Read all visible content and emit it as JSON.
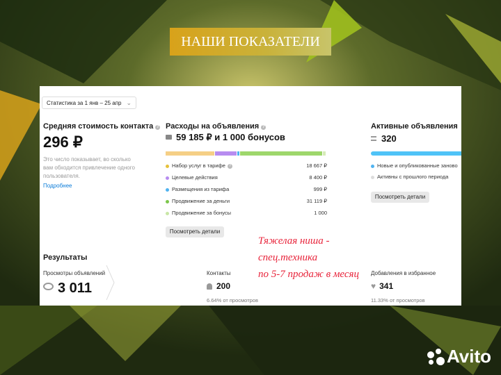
{
  "banner_title": "НАШИ ПОКАЗАТЕЛИ",
  "period_select": "Статистика за 1 янв – 25 апр",
  "contact_cost": {
    "title": "Средняя стоимость контакта",
    "value": "296 ₽",
    "hint": [
      "Это число показывает, во сколько",
      "вам обходится привлечение одного",
      "пользователя."
    ],
    "link": "Подробнее"
  },
  "expenses": {
    "title": "Расходы на объявления",
    "total_rub": "59 185 ₽",
    "total_rest": " и 1 000 бонусов",
    "items": [
      {
        "label": "Набор услуг в тарифе",
        "value": "18 667 ₽",
        "color": "#f5cf86"
      },
      {
        "label": "Целевые действия",
        "value": "8 400 ₽",
        "color": "#b78cf0"
      },
      {
        "label": "Размещения из тарифа",
        "value": "999 ₽",
        "color": "#4fb3f0"
      },
      {
        "label": "Продвижение за деньги",
        "value": "31 119 ₽",
        "color": "#9ed76b"
      },
      {
        "label": "Продвижение за бонусы",
        "value": "1 000",
        "color": "#d6ebb8"
      }
    ],
    "button": "Посмотреть детали"
  },
  "active_ads": {
    "title": "Активные объявления",
    "value": "320",
    "legend": [
      "Новые и опубликованные заново",
      "Активны с прошлого периода"
    ],
    "button": "Посмотреть детали"
  },
  "results": {
    "title": "Результаты",
    "views_label": "Просмотры объявлений",
    "views_value": "3 011",
    "contacts_label": "Контакты",
    "contacts_value": "200",
    "contacts_sub": "6.64% от просмотров",
    "favorites_label": "Добавления в избранное",
    "favorites_value": "341",
    "favorites_sub": "11.33% от просмотров"
  },
  "note": [
    "Тяжелая ниша -",
    "спец.техника",
    "по 5-7 продаж в месяц"
  ],
  "brand": "Avito",
  "colors": {
    "link": "#0a7bd8",
    "note": "#e8233a",
    "active_bar": "#4fc3f7"
  }
}
